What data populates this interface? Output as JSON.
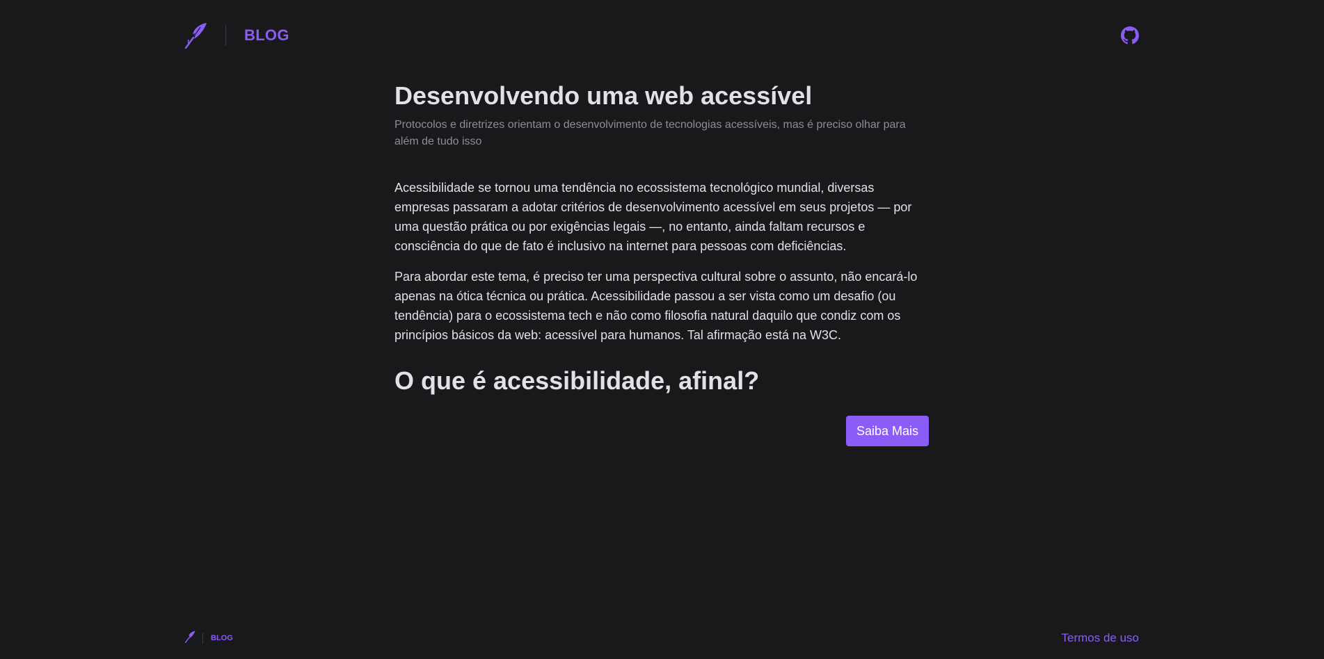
{
  "colors": {
    "background": "#19191c",
    "accent": "#8b5cf6",
    "heading": "#e1e1e6",
    "muted": "#8d8d99"
  },
  "header": {
    "logo_icon": "quill-feather-icon",
    "brand_label": "BLOG",
    "github_icon": "github-icon"
  },
  "article": {
    "title": "Desenvolvendo uma web acessível",
    "subtitle": "Protocolos e diretrizes orientam o desenvolvimento de tecnologias acessíveis, mas é preciso olhar para além de tudo isso",
    "paragraphs": [
      "Acessibilidade se tornou uma tendência no ecossistema tecnológico mundial, diversas empresas passaram a adotar critérios de desenvolvimento acessível em seus projetos — por uma questão prática ou por exigências legais —, no entanto, ainda faltam recursos e consciência do que de fato é inclusivo na internet para pessoas com deficiências.",
      "Para abordar este tema, é preciso ter uma perspectiva cultural sobre o assunto, não encará-lo apenas na ótica técnica ou prática. Acessibilidade passou a ser vista como um desafio (ou tendência) para o ecossistema tech e não como filosofia natural daquilo que condiz com os princípios básicos da web: acessível para humanos. Tal afirmação está na W3C."
    ],
    "section_heading": "O que é acessibilidade, afinal?",
    "cta_label": "Saiba Mais"
  },
  "footer": {
    "brand_label": "BLOG",
    "terms_label": "Termos de uso"
  }
}
